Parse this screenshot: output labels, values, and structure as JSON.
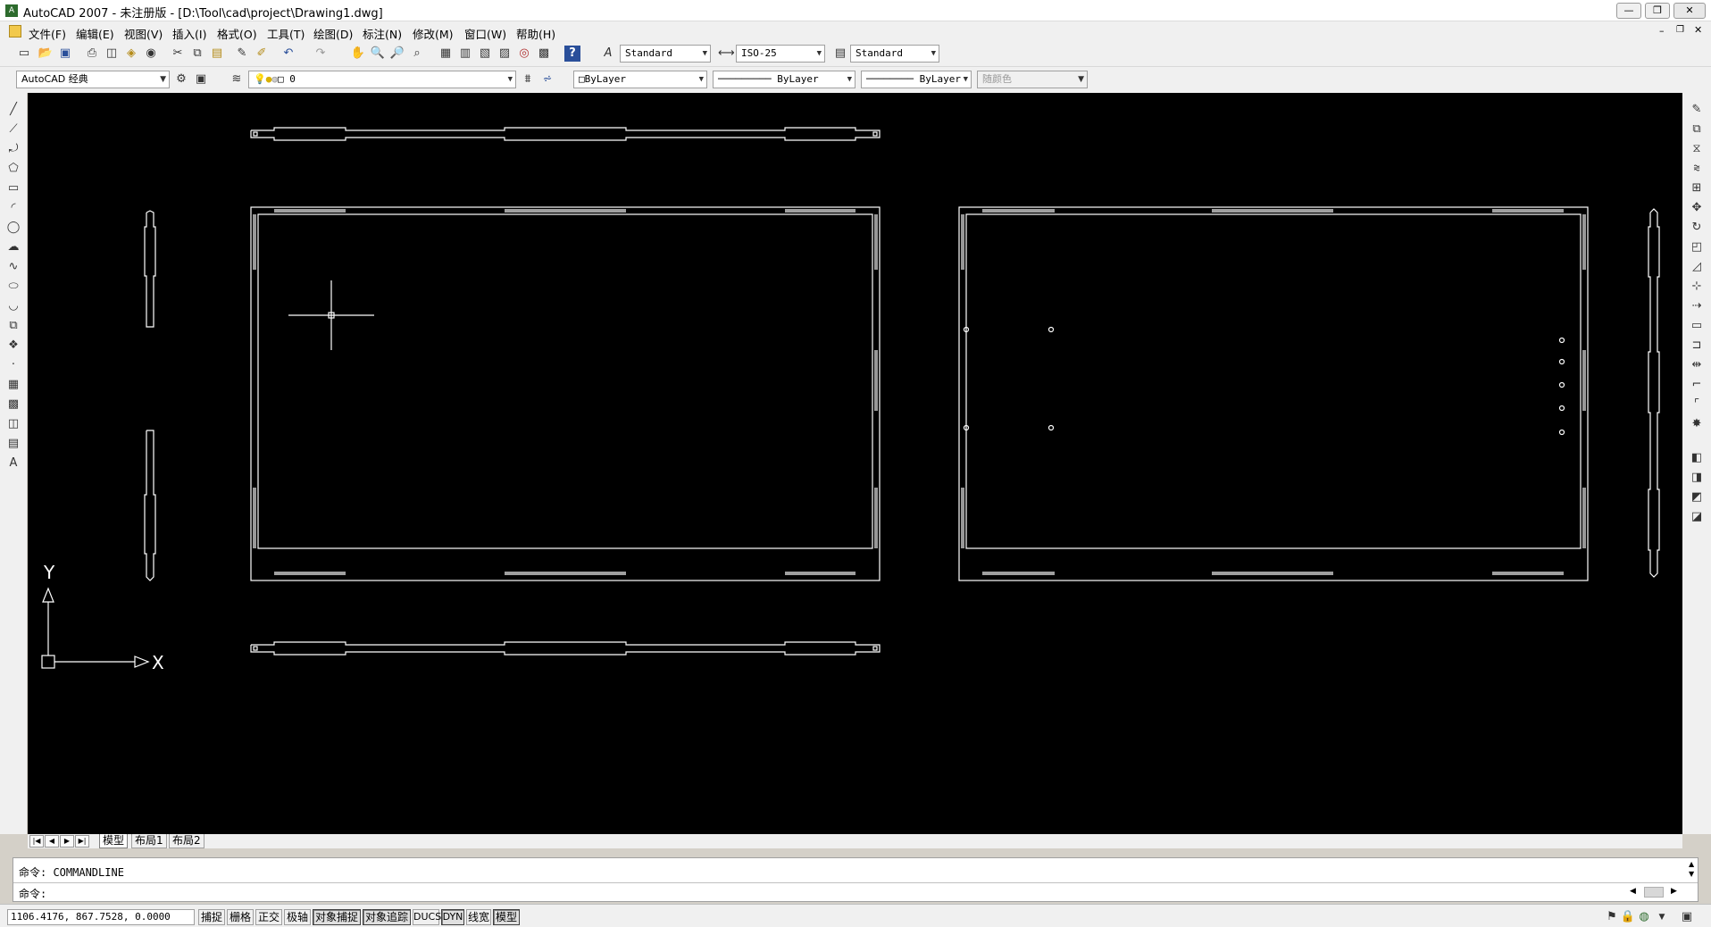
{
  "window": {
    "title": "AutoCAD 2007 - 未注册版 - [D:\\Tool\\cad\\project\\Drawing1.dwg]",
    "controls": [
      "—",
      "❐",
      "✕"
    ],
    "doc_controls": [
      "–",
      "❐",
      "✕"
    ]
  },
  "menu": [
    "文件(F)",
    "编辑(E)",
    "视图(V)",
    "插入(I)",
    "格式(O)",
    "工具(T)",
    "绘图(D)",
    "标注(N)",
    "修改(M)",
    "窗口(W)",
    "帮助(H)"
  ],
  "toolbar1": {
    "text_style": "Standard",
    "dim_style": "ISO-25",
    "table_style": "Standard"
  },
  "toolbar2": {
    "workspace": "AutoCAD 经典",
    "layer": "0",
    "color": "ByLayer",
    "linetype": "ByLayer",
    "lineweight": "ByLayer",
    "plotstyle": "随颜色"
  },
  "canvas": {
    "ucs_x_label": "X",
    "ucs_y_label": "Y",
    "background": "#000000",
    "line_color": "#ffffff"
  },
  "tabs": {
    "nav": [
      "|◀",
      "◀",
      "▶",
      "▶|"
    ],
    "items": [
      "模型",
      "布局1",
      "布局2"
    ],
    "active": "模型"
  },
  "command": {
    "history": "命令: COMMANDLINE",
    "prompt": "命令:"
  },
  "status": {
    "coords": "1106.4176, 867.7528, 0.0000",
    "buttons": [
      "捕捉",
      "栅格",
      "正交",
      "极轴",
      "对象捕捉",
      "对象追踪",
      "DUCS",
      "DYN",
      "线宽",
      "模型"
    ]
  }
}
